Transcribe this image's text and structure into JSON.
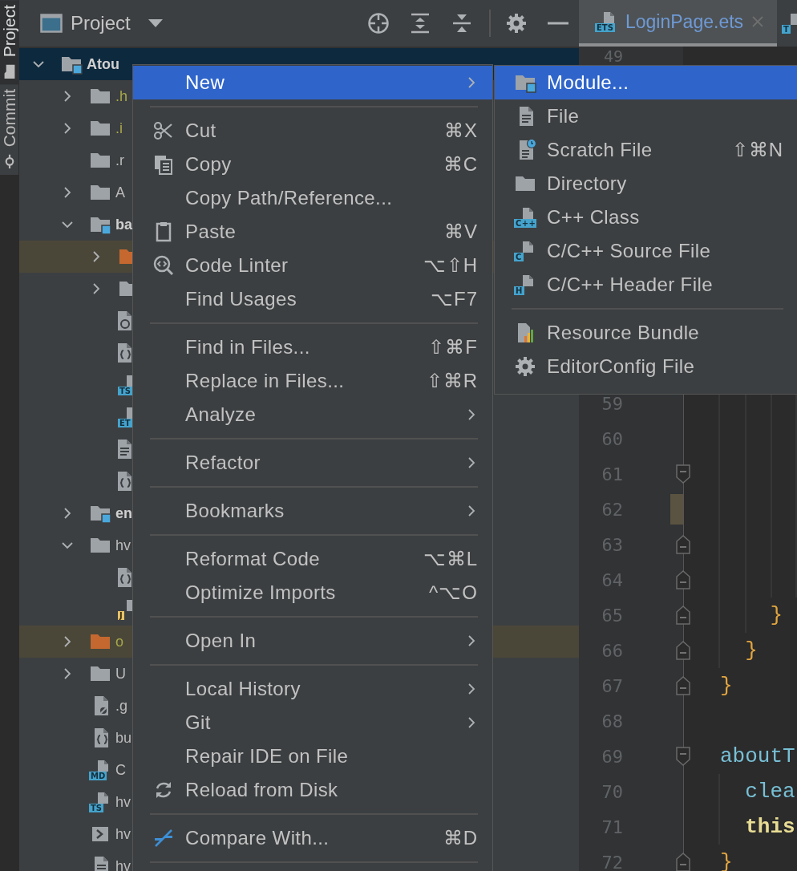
{
  "tool_stripe": [
    {
      "label": "Project",
      "selected": true
    },
    {
      "label": "Commit",
      "selected": false
    }
  ],
  "project_panel": {
    "title": "Project",
    "tree": [
      {
        "name": "Atou",
        "kind": "module",
        "expanded": true,
        "selected": true,
        "ignored": false,
        "children": [
          {
            "name": ".h",
            "kind": "folder",
            "expanded": false,
            "selected": false,
            "highlighted": false,
            "ignored": true
          },
          {
            "name": ".i",
            "kind": "folder",
            "expanded": false,
            "selected": false,
            "highlighted": false,
            "ignored": true
          },
          {
            "name": ".r",
            "kind": "folder",
            "selected": false,
            "highlighted": false,
            "ignored": false
          },
          {
            "name": "A",
            "kind": "folder",
            "expanded": false,
            "selected": false,
            "highlighted": false,
            "ignored": false
          },
          {
            "name": "ba",
            "kind": "module",
            "expanded": true,
            "selected": false,
            "highlighted": false,
            "ignored": false,
            "children": [
              {
                "kind": "excluded",
                "expanded": false,
                "selected": false,
                "highlighted": true
              },
              {
                "kind": "folder",
                "expanded": false,
                "selected": false,
                "highlighted": false
              },
              {
                "kind": "settings",
                "selected": false,
                "highlighted": false
              },
              {
                "kind": "braces",
                "selected": false,
                "highlighted": false
              },
              {
                "kind": "tagged",
                "badge": "TS",
                "selected": false,
                "highlighted": false
              },
              {
                "kind": "tagged",
                "badge": "ET",
                "selected": false,
                "highlighted": false
              },
              {
                "kind": "doc",
                "selected": false,
                "highlighted": false
              },
              {
                "kind": "braces",
                "selected": false,
                "highlighted": false
              }
            ]
          },
          {
            "name": "en",
            "kind": "module",
            "expanded": false,
            "selected": false,
            "highlighted": false,
            "ignored": false
          },
          {
            "name": "hv",
            "kind": "folder",
            "expanded": true,
            "selected": false,
            "highlighted": false,
            "ignored": false,
            "children": [
              {
                "kind": "braces",
                "selected": false,
                "highlighted": false
              },
              {
                "kind": "js",
                "badge": "J",
                "selected": false,
                "highlighted": false
              }
            ]
          },
          {
            "name": "o",
            "kind": "excluded",
            "expanded": false,
            "selected": false,
            "highlighted": true,
            "ignored": true
          },
          {
            "name": "U",
            "kind": "folder",
            "expanded": false,
            "selected": false,
            "highlighted": false,
            "ignored": false
          },
          {
            "name": ".g",
            "kind": "ignore",
            "selected": false,
            "highlighted": false,
            "ignored": false
          },
          {
            "name": "bu",
            "kind": "braces",
            "selected": false,
            "highlighted": false,
            "ignored": false
          },
          {
            "name": "C",
            "kind": "tagged",
            "badge": "MD",
            "selected": false,
            "highlighted": false,
            "ignored": false
          },
          {
            "name": "hv",
            "kind": "tagged",
            "badge": "TS",
            "selected": false,
            "highlighted": false,
            "ignored": false
          },
          {
            "name": "hv",
            "kind": "shell",
            "selected": false,
            "highlighted": false,
            "ignored": false
          },
          {
            "name": "hv",
            "kind": "doc",
            "selected": false,
            "highlighted": false,
            "ignored": false
          }
        ]
      }
    ]
  },
  "editor": {
    "tabs": [
      {
        "label": "LoginPage.ets",
        "badge": "ETS",
        "selected": true
      },
      {
        "badge": "T",
        "selected": false
      }
    ],
    "first_line": {
      "number": "49"
    },
    "lines": [
      {
        "number": "59",
        "kind": "plain",
        "changed": false
      },
      {
        "number": "60",
        "kind": "plain",
        "changed": false
      },
      {
        "number": "61",
        "kind": "opener",
        "changed": false
      },
      {
        "number": "62",
        "kind": "plain",
        "changed": true
      },
      {
        "number": "63",
        "kind": "closer",
        "changed": false
      },
      {
        "number": "64",
        "kind": "closer",
        "changed": false
      },
      {
        "number": "65",
        "kind": "closer",
        "changed": false,
        "tokens": [
          {
            "text": "    }",
            "kind": "brace"
          }
        ]
      },
      {
        "number": "66",
        "kind": "closer",
        "changed": false,
        "tokens": [
          {
            "text": "  }",
            "kind": "brace"
          }
        ]
      },
      {
        "number": "67",
        "kind": "closer",
        "changed": false,
        "tokens": [
          {
            "text": "}",
            "kind": "brace"
          }
        ]
      },
      {
        "number": "68",
        "kind": "plain",
        "changed": false
      },
      {
        "number": "69",
        "kind": "opener",
        "changed": false,
        "tokens": [
          {
            "text": "aboutT",
            "kind": "method"
          }
        ]
      },
      {
        "number": "70",
        "kind": "plain",
        "changed": false,
        "tokens": [
          {
            "text": "  clea",
            "kind": "method"
          }
        ]
      },
      {
        "number": "71",
        "kind": "plain",
        "changed": false,
        "tokens": [
          {
            "text": "  this",
            "kind": "keyword"
          }
        ]
      },
      {
        "number": "72",
        "kind": "closer",
        "changed": false,
        "tokens": [
          {
            "text": "}",
            "kind": "brace"
          }
        ]
      }
    ]
  },
  "context_menu": {
    "items": [
      {
        "kind": "plain",
        "label": "New",
        "submenu": true,
        "selected": true
      },
      {
        "kind": "separator"
      },
      {
        "kind": "scissors",
        "label": "Cut",
        "shortcut": "⌘X",
        "selected": false
      },
      {
        "kind": "copy",
        "label": "Copy",
        "shortcut": "⌘C",
        "selected": false
      },
      {
        "kind": "plain",
        "label": "Copy Path/Reference...",
        "selected": false
      },
      {
        "kind": "clipboard",
        "label": "Paste",
        "shortcut": "⌘V",
        "selected": false
      },
      {
        "kind": "linter",
        "label": "Code Linter",
        "shortcut": "⌥⇧H",
        "selected": false
      },
      {
        "kind": "plain",
        "label": "Find Usages",
        "shortcut": "⌥F7",
        "selected": false
      },
      {
        "kind": "separator"
      },
      {
        "kind": "plain",
        "label": "Find in Files...",
        "shortcut": "⇧⌘F",
        "selected": false
      },
      {
        "kind": "plain",
        "label": "Replace in Files...",
        "shortcut": "⇧⌘R",
        "selected": false
      },
      {
        "kind": "plain",
        "label": "Analyze",
        "submenu": true,
        "selected": false
      },
      {
        "kind": "separator"
      },
      {
        "kind": "plain",
        "label": "Refactor",
        "submenu": true,
        "selected": false
      },
      {
        "kind": "separator"
      },
      {
        "kind": "plain",
        "label": "Bookmarks",
        "submenu": true,
        "selected": false
      },
      {
        "kind": "separator"
      },
      {
        "kind": "plain",
        "label": "Reformat Code",
        "shortcut": "⌥⌘L",
        "selected": false
      },
      {
        "kind": "plain",
        "label": "Optimize Imports",
        "shortcut": "^⌥O",
        "selected": false
      },
      {
        "kind": "separator"
      },
      {
        "kind": "plain",
        "label": "Open In",
        "submenu": true,
        "selected": false
      },
      {
        "kind": "separator"
      },
      {
        "kind": "plain",
        "label": "Local History",
        "submenu": true,
        "selected": false
      },
      {
        "kind": "plain",
        "label": "Git",
        "submenu": true,
        "selected": false
      },
      {
        "kind": "plain",
        "label": "Repair IDE on File",
        "selected": false
      },
      {
        "kind": "reload",
        "label": "Reload from Disk",
        "selected": false
      },
      {
        "kind": "separator"
      },
      {
        "kind": "compare",
        "label": "Compare With...",
        "shortcut": "⌘D",
        "selected": false
      },
      {
        "kind": "separator"
      }
    ]
  },
  "submenu": {
    "items": [
      {
        "kind": "module",
        "label": "Module...",
        "selected": true
      },
      {
        "kind": "file",
        "label": "File",
        "selected": false
      },
      {
        "kind": "scratch",
        "label": "Scratch File",
        "shortcut": "⇧⌘N",
        "selected": false
      },
      {
        "kind": "folder",
        "label": "Directory",
        "selected": false
      },
      {
        "kind": "tagged",
        "badge": "C++",
        "label": "C++ Class",
        "selected": false
      },
      {
        "kind": "tagged",
        "badge": "C",
        "label": "C/C++ Source File",
        "selected": false
      },
      {
        "kind": "tagged",
        "badge": "H",
        "label": "C/C++ Header File",
        "selected": false
      },
      {
        "kind": "separator"
      },
      {
        "kind": "bundle",
        "label": "Resource Bundle",
        "selected": false
      },
      {
        "kind": "gear",
        "label": "EditorConfig File",
        "selected": false
      }
    ]
  }
}
